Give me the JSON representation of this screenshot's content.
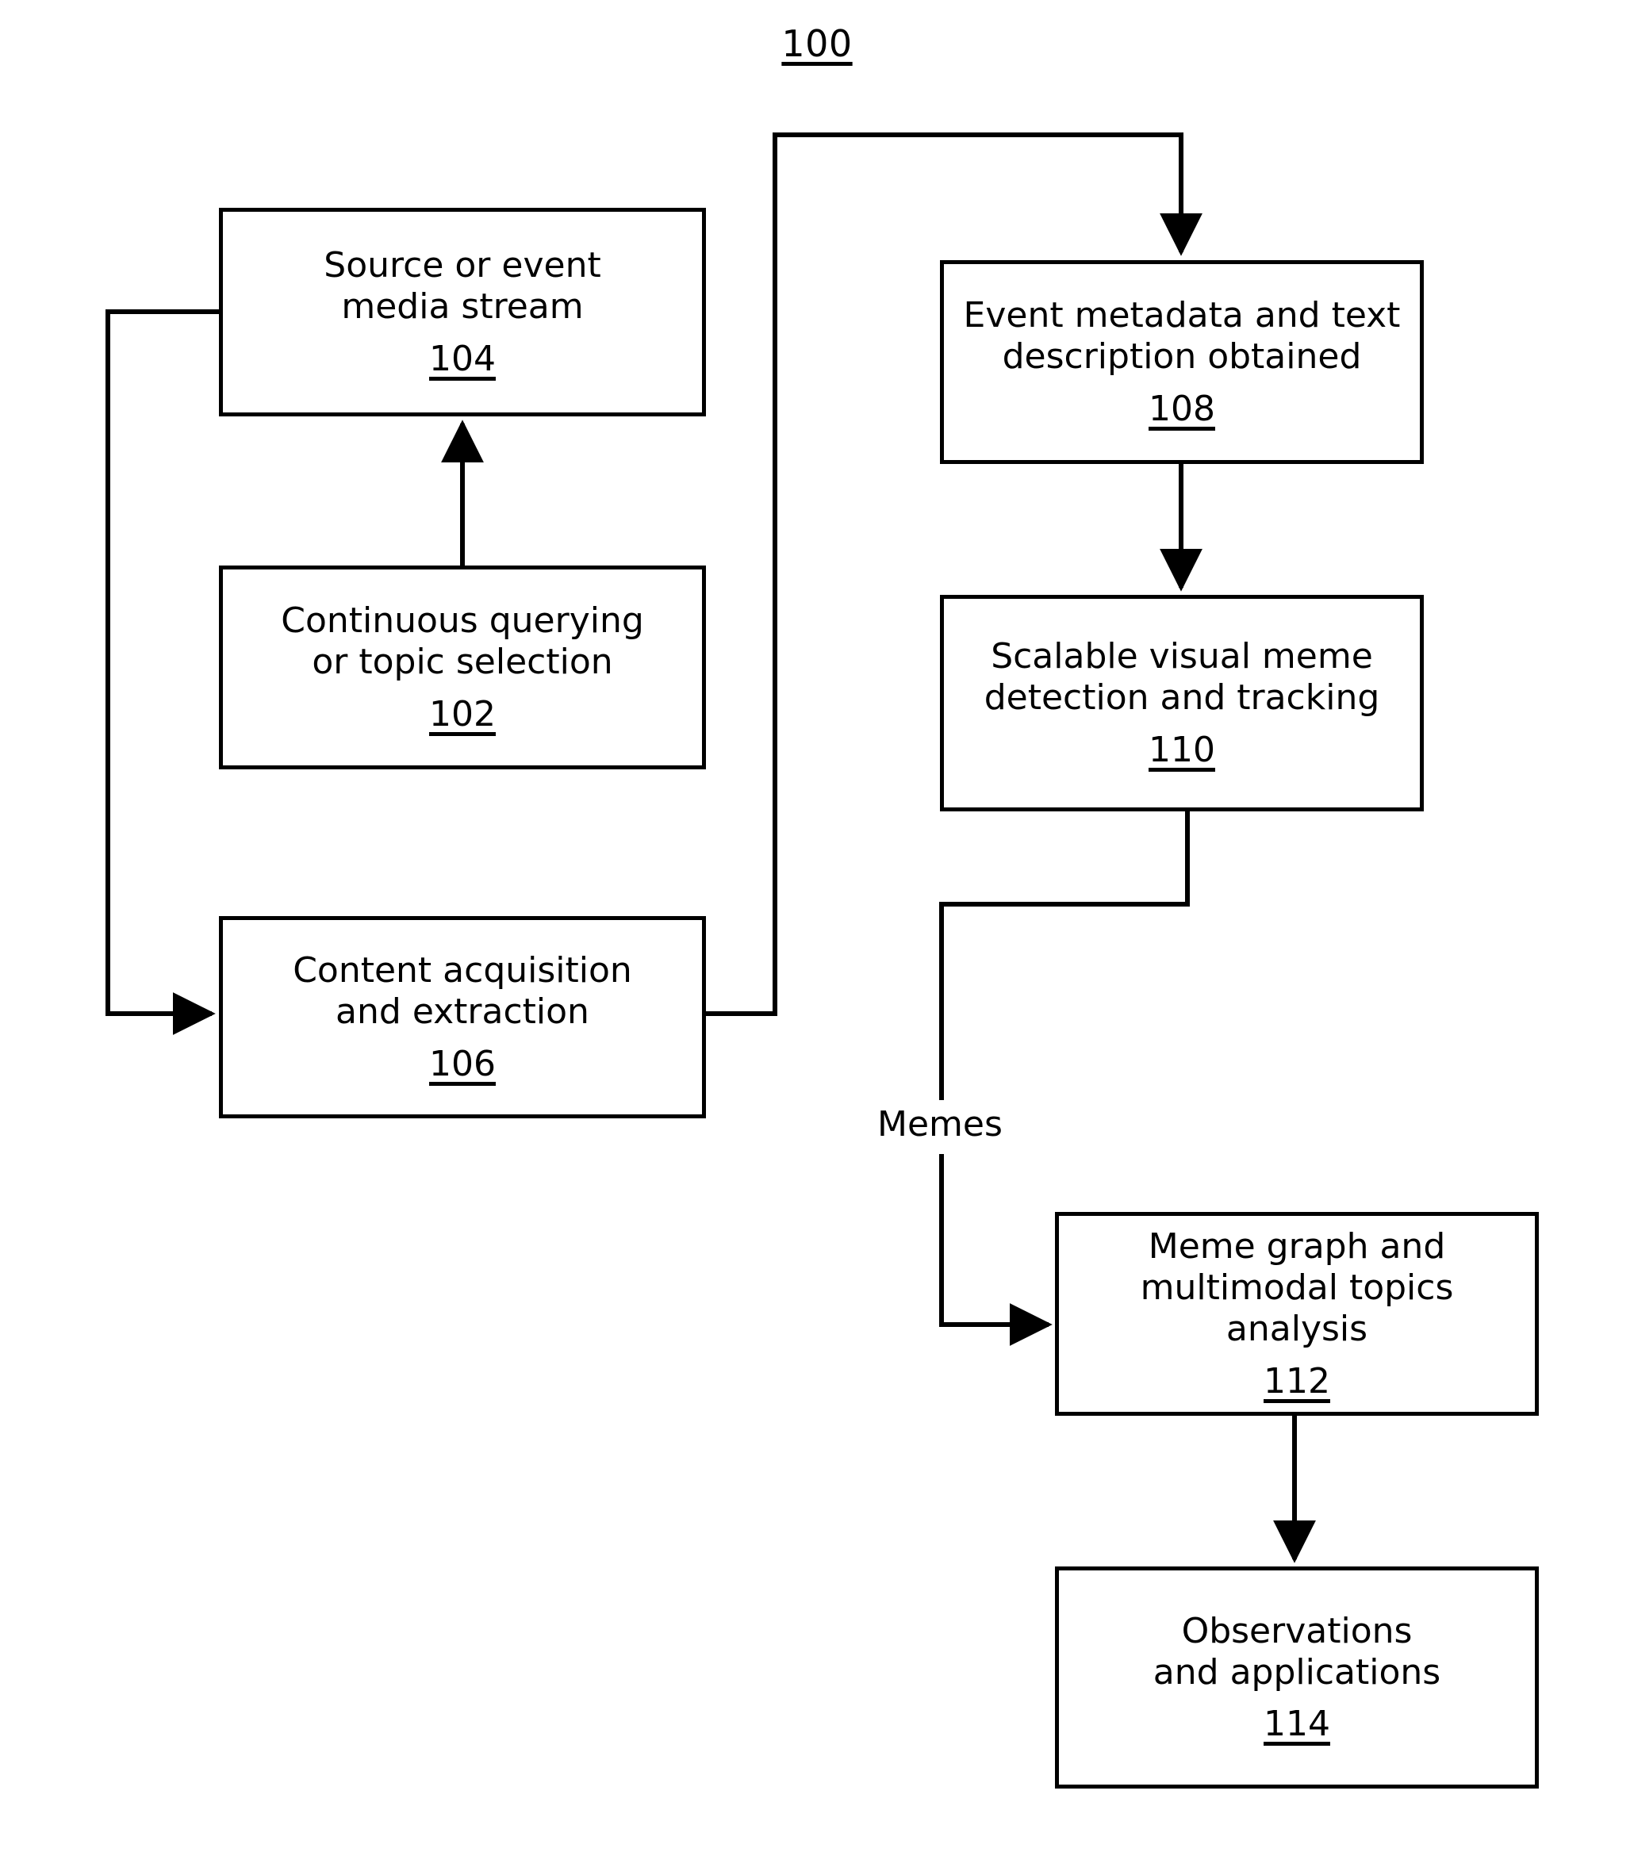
{
  "figure": {
    "reference_numeral": "100",
    "type": "patent-flowchart"
  },
  "nodes": [
    {
      "id": "node-104",
      "name": "source-or-event-media-stream",
      "label": "Source or event\nmedia stream",
      "ref": "104"
    },
    {
      "id": "node-102",
      "name": "continuous-querying-or-topic-selection",
      "label": "Continuous querying\nor topic selection",
      "ref": "102"
    },
    {
      "id": "node-106",
      "name": "content-acquisition-and-extraction",
      "label": "Content acquisition\nand extraction",
      "ref": "106"
    },
    {
      "id": "node-108",
      "name": "event-metadata-and-text-description-obtained",
      "label": "Event metadata and text\ndescription obtained",
      "ref": "108"
    },
    {
      "id": "node-110",
      "name": "scalable-visual-meme-detection-and-tracking",
      "label": "Scalable visual meme\ndetection and tracking",
      "ref": "110"
    },
    {
      "id": "node-112",
      "name": "meme-graph-and-multimodal-topics-analysis",
      "label": "Meme graph and\nmultimodal topics analysis",
      "ref": "112"
    },
    {
      "id": "node-114",
      "name": "observations-and-applications",
      "label": "Observations\nand applications",
      "ref": "114"
    }
  ],
  "edge_labels": [
    {
      "id": "edge-label-memes",
      "name": "memes-edge-label",
      "text": "Memes"
    }
  ],
  "style": {
    "line_color": "#000000",
    "background": "#ffffff",
    "box_fill": "#ffffff"
  }
}
